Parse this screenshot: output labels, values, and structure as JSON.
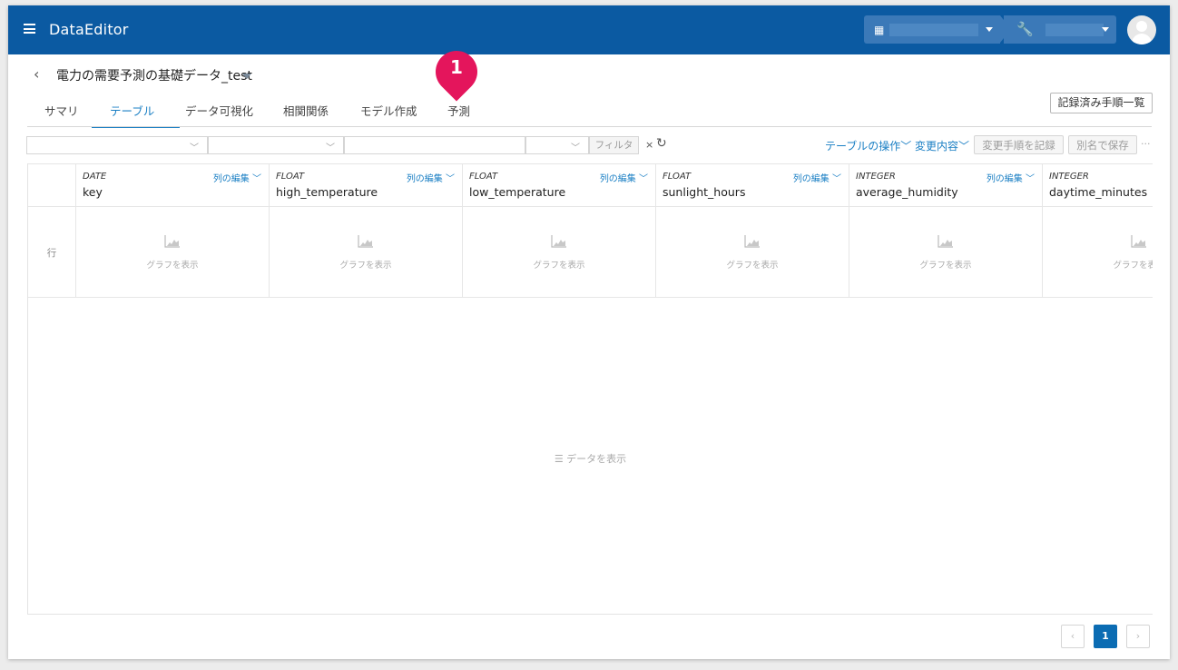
{
  "app": {
    "title": "DataEditor"
  },
  "topbar": {
    "org_icon": "building-icon",
    "tool_icon": "wrench-icon"
  },
  "dataset": {
    "title": "電力の需要予測の基礎データ_test"
  },
  "marker": {
    "number": "1"
  },
  "tabs": [
    {
      "label": "サマリ",
      "active": false
    },
    {
      "label": "テーブル",
      "active": true
    },
    {
      "label": "データ可視化",
      "active": false
    },
    {
      "label": "相関関係",
      "active": false
    },
    {
      "label": "モデル作成",
      "active": false
    },
    {
      "label": "予測",
      "active": false
    }
  ],
  "toolbar": {
    "history_button": "記録済み手順一覧",
    "filter_button": "フィルタ",
    "clear": "×",
    "table_ops": "テーブルの操作",
    "changes": "変更内容",
    "record_steps": "変更手順を記録",
    "save_as": "別名で保存",
    "more": "···"
  },
  "table": {
    "row_label": "行",
    "edit_label": "列の編集",
    "graph_label": "グラフを表示",
    "show_data": "データを表示",
    "columns": [
      {
        "type": "DATE",
        "name": "key"
      },
      {
        "type": "FLOAT",
        "name": "high_temperature"
      },
      {
        "type": "FLOAT",
        "name": "low_temperature"
      },
      {
        "type": "FLOAT",
        "name": "sunlight_hours"
      },
      {
        "type": "INTEGER",
        "name": "average_humidity"
      },
      {
        "type": "INTEGER",
        "name": "daytime_minutes"
      }
    ]
  },
  "pagination": {
    "prev": "‹",
    "current": "1",
    "next": "›"
  },
  "colors": {
    "header_bg": "#0b5aa2",
    "accent": "#1a7fc4",
    "marker": "#e4155c"
  }
}
